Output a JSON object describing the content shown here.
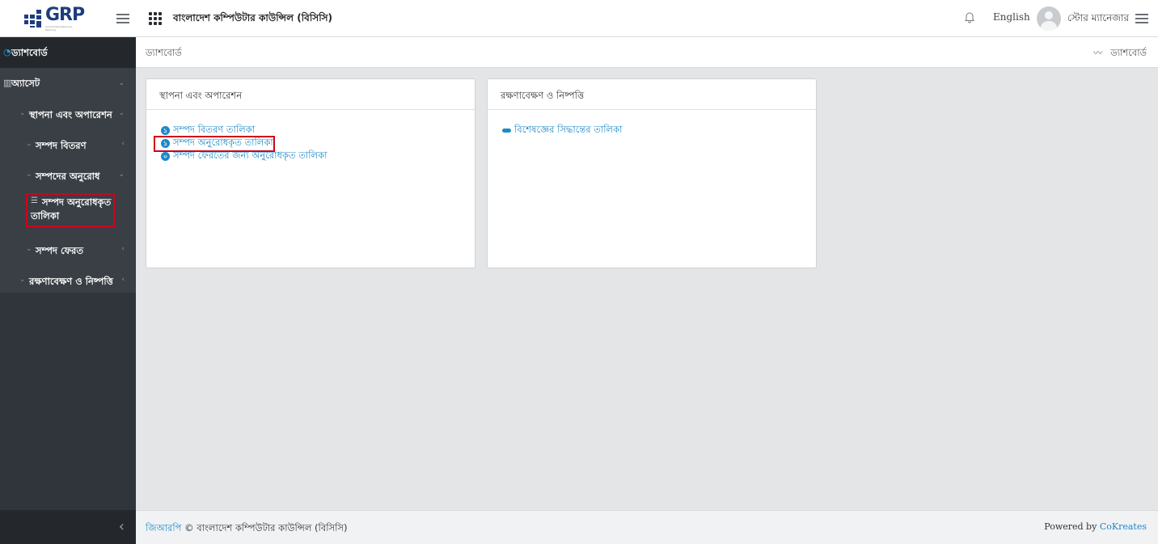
{
  "header": {
    "logo_text": "GRP",
    "logo_subtext": "Government Resource Planning",
    "org_title": "বাংলাদেশ কম্পিউটার কাউন্সিল (বিসিসি)",
    "language": "English",
    "username": "স্টোর ম্যানেজার"
  },
  "sidebar": {
    "dashboard": "ড্যাশবোর্ড",
    "asset": "অ্যাসেট",
    "install_ops": "স্থাপনা এবং অপারেশন",
    "asset_distribution": "সম্পদ বিতরণ",
    "asset_request": "সম্পদের অনুরোধ",
    "requested_list": "সম্পদ অনুরোধকৃত তালিকা",
    "asset_return": "সম্পদ ফেরত",
    "maintenance": "রক্ষণাবেক্ষণ ও নিষ্পত্তি"
  },
  "breadcrumb": {
    "current": "ড্যাশবোর্ড",
    "right": "ড্যাশবোর্ড"
  },
  "cards": [
    {
      "title": "স্থাপনা এবং অপারেশন",
      "links": [
        {
          "badge": "১",
          "label": "সম্পদ বিতরণ তালিকা"
        },
        {
          "badge": "১",
          "label": "সম্পদ অনুরোধকৃত তালিকা"
        },
        {
          "badge": "০",
          "label": "সম্পদ ফেরতের জন্য অনুরোধকৃত তালিকা"
        }
      ]
    },
    {
      "title": "রক্ষণাবেক্ষণ ও নিষ্পত্তি",
      "links": [
        {
          "badge": "",
          "label": "বিশেষজ্ঞের সিদ্ধান্তের তালিকা"
        }
      ]
    }
  ],
  "footer": {
    "brand_link": "জিআরপি",
    "copyright": "© বাংলাদেশ কম্পিউটার কাউন্সিল (বিসিসি)",
    "powered_by": "Powered by",
    "powered_link": "CoKreates"
  },
  "colors": {
    "accent": "#1e88c8",
    "sidebar_bg": "#2f353a",
    "highlight": "#d0021b"
  }
}
